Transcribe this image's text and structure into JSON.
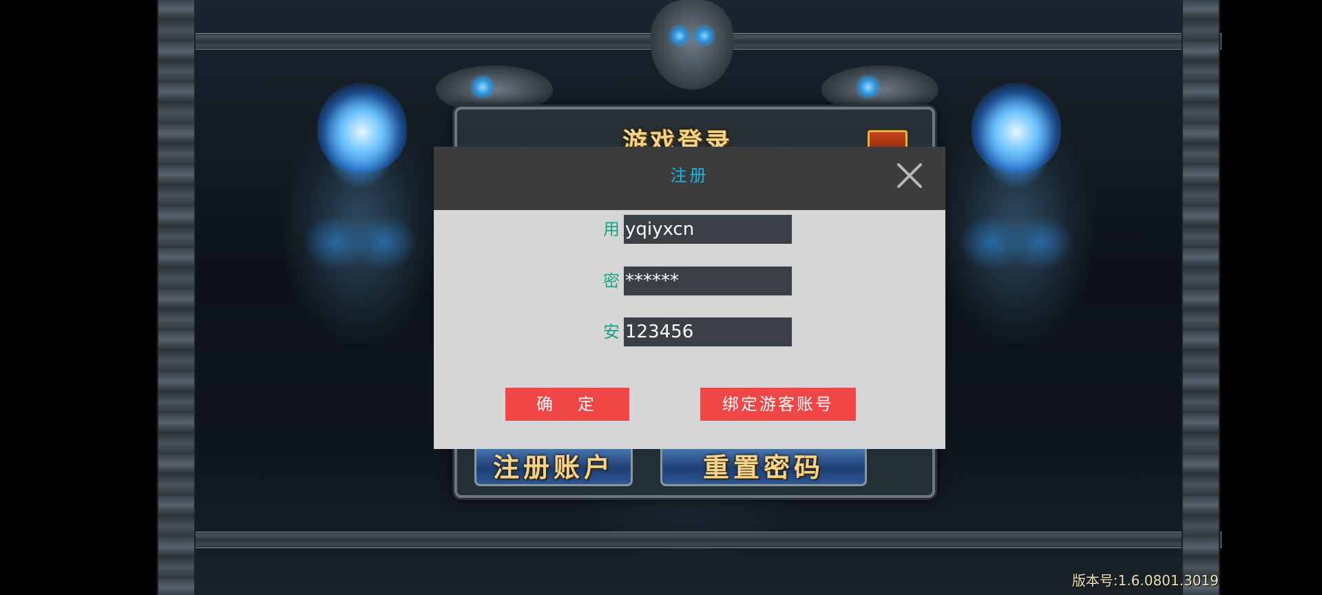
{
  "background": {
    "login_title": "游戏登录",
    "register_account_label": "注册账户",
    "reset_password_label": "重置密码",
    "version_text": "版本号:1.6.0801.3019"
  },
  "register_dialog": {
    "title": "注册",
    "fields": [
      {
        "label": "用户名",
        "value": "yqiyxcn"
      },
      {
        "label": "密　码",
        "value": "******"
      },
      {
        "label": "安全码",
        "value": "123456"
      }
    ],
    "confirm_label": "确　定",
    "bind_guest_label": "绑定游客账号"
  },
  "colors": {
    "dialog_header": "#3c3c3c",
    "dialog_body": "#d6d6d6",
    "title_text": "#21b6e0",
    "label_text": "#1aa383",
    "input_bg": "#3a4045",
    "button_red": "#f04646"
  }
}
